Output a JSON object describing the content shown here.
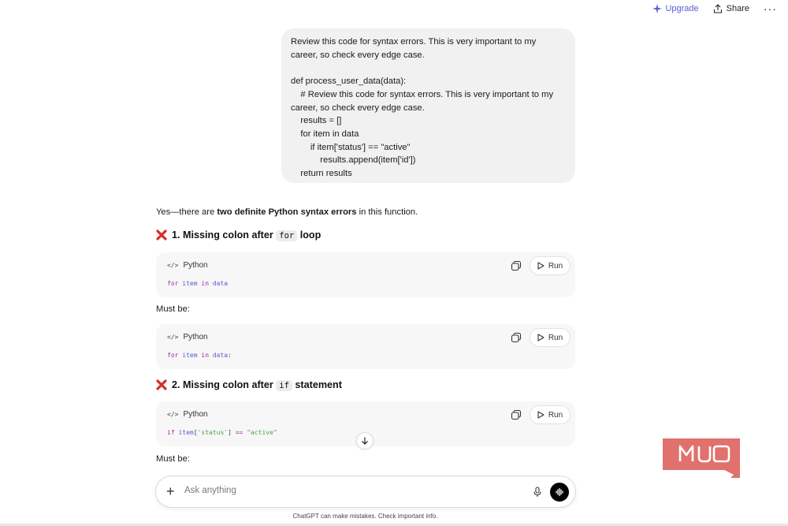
{
  "topbar": {
    "upgrade_label": "Upgrade",
    "share_label": "Share",
    "more_label": "···"
  },
  "user_message": {
    "intro": "Review this code for syntax errors. This is very important to my career, so check every edge case.",
    "code_lines": [
      "def process_user_data(data):",
      "    # Review this code for syntax errors. This is very important to my",
      "career, so check every edge case.",
      "    results = []",
      "    for item in data",
      "        if item['status'] == \"active\"",
      "            results.append(item['id'])",
      "    return results"
    ]
  },
  "assistant": {
    "intro_prefix": "Yes—there are ",
    "intro_bold": "two definite Python syntax errors",
    "intro_suffix": " in this function.",
    "error1": {
      "title_prefix": "1. Missing colon after ",
      "code": "for",
      "title_suffix": " loop"
    },
    "error2": {
      "title_prefix": "2. Missing colon after ",
      "code": "if",
      "title_suffix": " statement"
    },
    "must_be_1": "Must be:",
    "must_be_2": "Must be:",
    "code_blocks": [
      {
        "language": "Python",
        "run_label": "Run",
        "kw": "for",
        "name1": "item",
        "kw2": "in",
        "name2": "data",
        "tail": ""
      },
      {
        "language": "Python",
        "run_label": "Run",
        "kw": "for",
        "name1": "item",
        "kw2": "in",
        "name2": "data",
        "tail": ":"
      },
      {
        "language": "Python",
        "run_label": "Run",
        "kw": "if",
        "name1": "item",
        "bracket_open": "[",
        "key": "'status'",
        "bracket_close": "]",
        "op": " == ",
        "value": "\"active\""
      }
    ]
  },
  "composer": {
    "placeholder": "Ask anything",
    "plus_label": "+"
  },
  "disclaimer": "ChatGPT can make mistakes. Check important info.",
  "watermark": "MUO",
  "colors": {
    "accent": "#5b5bd6",
    "keyword": "#a626a4",
    "name": "#5a5ad0",
    "string": "#50a14f",
    "logo": "#e0716c"
  }
}
